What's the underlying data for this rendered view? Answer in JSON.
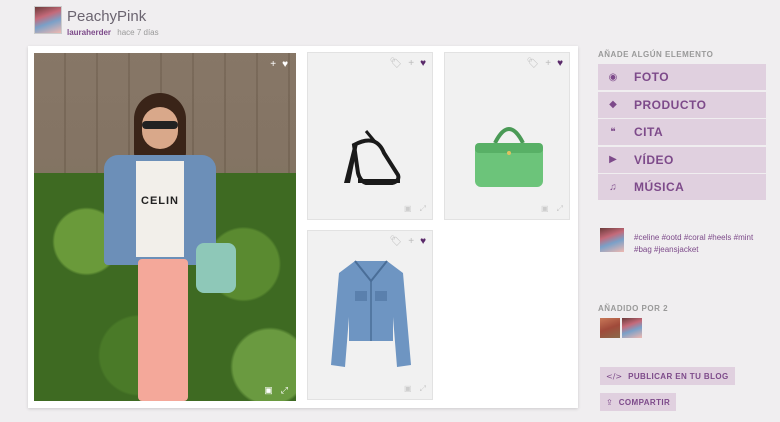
{
  "header": {
    "title": "PeachyPink",
    "username": "lauraherder",
    "time": "hace 7 días"
  },
  "board": {
    "photo_tools": [
      "+",
      "♥"
    ],
    "photo_foot": [
      "▣",
      "⤢"
    ],
    "products": [
      {
        "name": "sandals",
        "tools": [
          "🏷",
          "+",
          "♥"
        ],
        "foot": [
          "▣",
          "⤢"
        ]
      },
      {
        "name": "green-bag",
        "tools": [
          "🏷",
          "+",
          "♥"
        ],
        "foot": [
          "▣",
          "⤢"
        ]
      },
      {
        "name": "denim-jacket",
        "tools": [
          "🏷",
          "+",
          "♥"
        ],
        "foot": [
          "▣",
          "⤢"
        ]
      }
    ],
    "shirt_text": "CELIN"
  },
  "sidebar": {
    "add_heading": "AÑADE ALGÚN ELEMENTO",
    "add_items": [
      {
        "label": "FOTO",
        "icon": "camera-icon",
        "glyph": "◉"
      },
      {
        "label": "PRODUCTO",
        "icon": "tag-icon",
        "glyph": "◆"
      },
      {
        "label": "CITA",
        "icon": "quote-icon",
        "glyph": "❝"
      },
      {
        "label": "VÍDEO",
        "icon": "play-icon",
        "glyph": "▶"
      },
      {
        "label": "MÚSICA",
        "icon": "headphones-icon",
        "glyph": "♫"
      }
    ],
    "tags": "#celine #ootd #coral #heels #mint #bag #jeansjacket",
    "added_heading": "AÑADIDO POR 2",
    "publish_label": "PUBLICAR EN TU BLOG",
    "publish_glyph": "</>",
    "share_label": "COMPARTIR",
    "share_glyph": "⇪"
  },
  "colors": {
    "accent": "#7d4a8a",
    "sidebar_button_bg": "#e0d0df",
    "heart": "#5a2a6a"
  }
}
